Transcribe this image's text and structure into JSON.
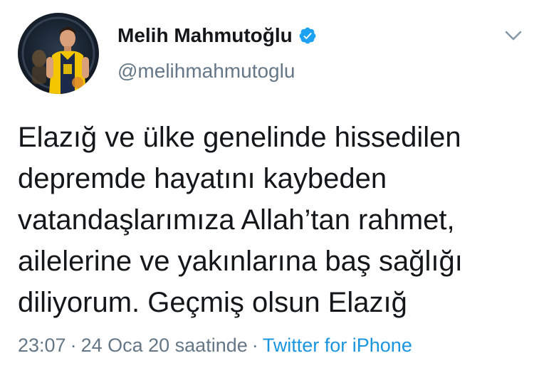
{
  "user": {
    "display_name": "Melih Mahmutoğlu",
    "handle": "@melihmahmutoglu",
    "verified_icon": "verified-badge-icon",
    "avatar_icon": "profile-avatar"
  },
  "tweet": {
    "text": "Elazığ ve ülke genelinde hissedilen\ndepremde hayatını kaybeden\nvatandaşlarımıza Allah’tan rahmet,\nailelerine ve yakınlarına baş sağlığı\ndiliyorum. Geçmiş olsun Elazığ"
  },
  "meta": {
    "time": "23:07",
    "separator": "·",
    "date_phrase": "24 Oca 20 saatinde",
    "source": "Twitter for iPhone"
  },
  "menu": {
    "icon": "chevron-down-icon"
  },
  "colors": {
    "verified": "#1da1f2",
    "link": "#1b95e0",
    "secondary_text": "#657786",
    "primary_text": "#14171a",
    "jersey_yellow": "#f2c500",
    "jersey_navy": "#1b2a4a"
  }
}
